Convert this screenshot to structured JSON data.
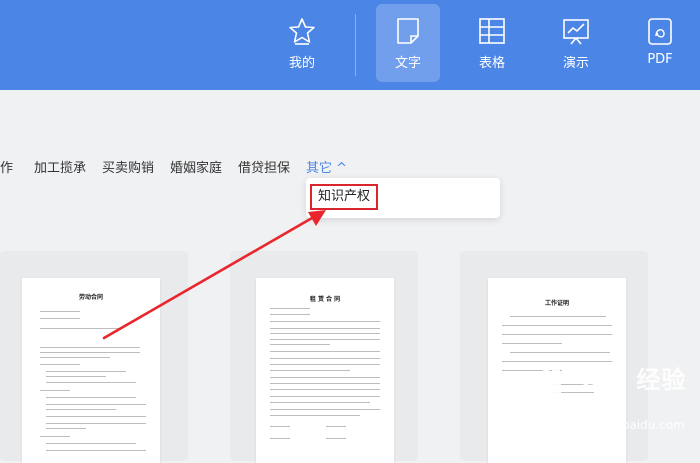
{
  "nav": {
    "items": [
      {
        "label": "我的",
        "icon": "star-icon"
      },
      {
        "label": "文字",
        "icon": "document-icon",
        "active": true
      },
      {
        "label": "表格",
        "icon": "table-icon"
      },
      {
        "label": "演示",
        "icon": "presentation-icon"
      },
      {
        "label": "PDF",
        "icon": "pdf-icon"
      }
    ]
  },
  "categories": {
    "items": [
      "作",
      "加工揽承",
      "买卖购销",
      "婚姻家庭",
      "借贷担保"
    ],
    "more": "其它 ^"
  },
  "dropdown": {
    "items": [
      "知识产权"
    ]
  },
  "templates": [
    {
      "title": "劳动合同"
    },
    {
      "title": "租 赁 合 同"
    },
    {
      "title": "工作证明"
    }
  ],
  "watermark": {
    "text": "Bai 经验",
    "url": "jingyan.baidu.com"
  },
  "colors": {
    "topbar": "#4b85e6",
    "highlight": "#d9262c",
    "link": "#4b85e6"
  }
}
